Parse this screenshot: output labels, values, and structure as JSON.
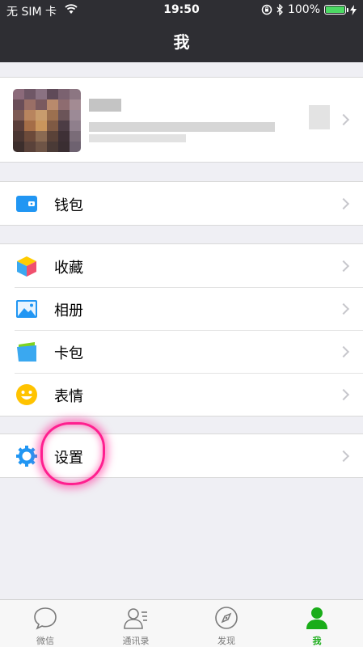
{
  "status_bar": {
    "carrier": "无 SIM 卡",
    "time": "19:50",
    "battery_percent": "100%",
    "battery_level": 1.0
  },
  "nav": {
    "title": "我"
  },
  "profile": {
    "avatar_icon": "avatar-icon",
    "chevron_icon": "chevron-right-icon"
  },
  "menu": {
    "wallet": {
      "label": "钱包",
      "icon": "wallet-icon"
    },
    "favorites": {
      "label": "收藏",
      "icon": "cube-icon"
    },
    "album": {
      "label": "相册",
      "icon": "photo-icon"
    },
    "cards": {
      "label": "卡包",
      "icon": "card-icon"
    },
    "stickers": {
      "label": "表情",
      "icon": "smiley-icon"
    },
    "settings": {
      "label": "设置",
      "icon": "gear-icon"
    }
  },
  "tabs": [
    {
      "label": "微信",
      "icon": "chat-bubble-icon",
      "active": false
    },
    {
      "label": "通讯录",
      "icon": "contacts-icon",
      "active": false
    },
    {
      "label": "发现",
      "icon": "compass-icon",
      "active": false
    },
    {
      "label": "我",
      "icon": "person-icon",
      "active": true
    }
  ],
  "colors": {
    "accent_active": "#1aad19",
    "nav_background": "#2e2e33",
    "page_background": "#efeff4",
    "highlight_marker": "#ff1f8f"
  }
}
